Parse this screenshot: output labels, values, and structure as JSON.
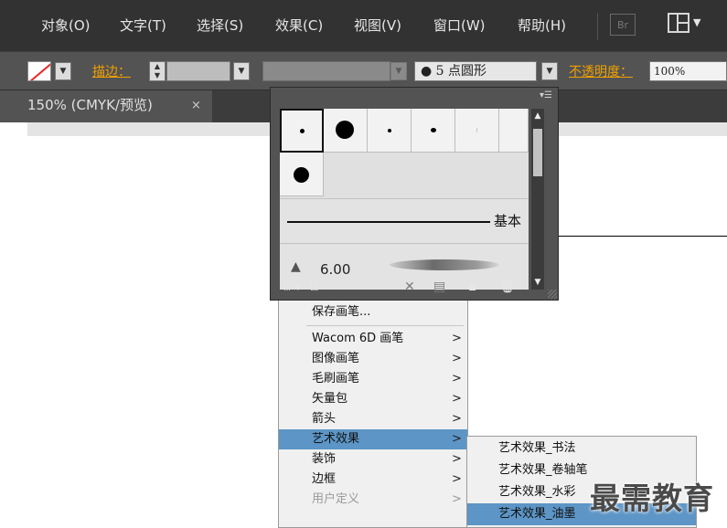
{
  "menubar": {
    "items": [
      "对象(O)",
      "文字(T)",
      "选择(S)",
      "效果(C)",
      "视图(V)",
      "窗口(W)",
      "帮助(H)"
    ],
    "bridge_label": "Br"
  },
  "control_bar": {
    "stroke_label": "描边：",
    "brush_definition": "5 点圆形",
    "opacity_label": "不透明度：",
    "opacity_value": "100%"
  },
  "document_tab": {
    "title": "150% (CMYK/预览)",
    "close": "×"
  },
  "brush_panel": {
    "basic_label": "基本",
    "art_brush_size": "6.00"
  },
  "library_menu": {
    "items": [
      {
        "label": "保存画笔...",
        "submenu": false
      },
      {
        "label": "Wacom 6D 画笔",
        "submenu": true
      },
      {
        "label": "图像画笔",
        "submenu": true
      },
      {
        "label": "毛刷画笔",
        "submenu": true
      },
      {
        "label": "矢量包",
        "submenu": true
      },
      {
        "label": "箭头",
        "submenu": true
      },
      {
        "label": "艺术效果",
        "submenu": true,
        "highlighted": true
      },
      {
        "label": "装饰",
        "submenu": true
      },
      {
        "label": "边框",
        "submenu": true
      },
      {
        "label": "用户定义",
        "submenu": true,
        "disabled": true
      }
    ],
    "arrow_glyph": ">"
  },
  "art_effects_submenu": {
    "items": [
      {
        "label": "艺术效果_书法"
      },
      {
        "label": "艺术效果_卷轴笔"
      },
      {
        "label": "艺术效果_水彩"
      },
      {
        "label": "艺术效果_油墨",
        "highlighted": true
      }
    ]
  },
  "watermark": "最需教育",
  "colors": {
    "highlight": "#5c95c6",
    "label_orange": "#f0a000",
    "dark_ui": "#323232"
  }
}
